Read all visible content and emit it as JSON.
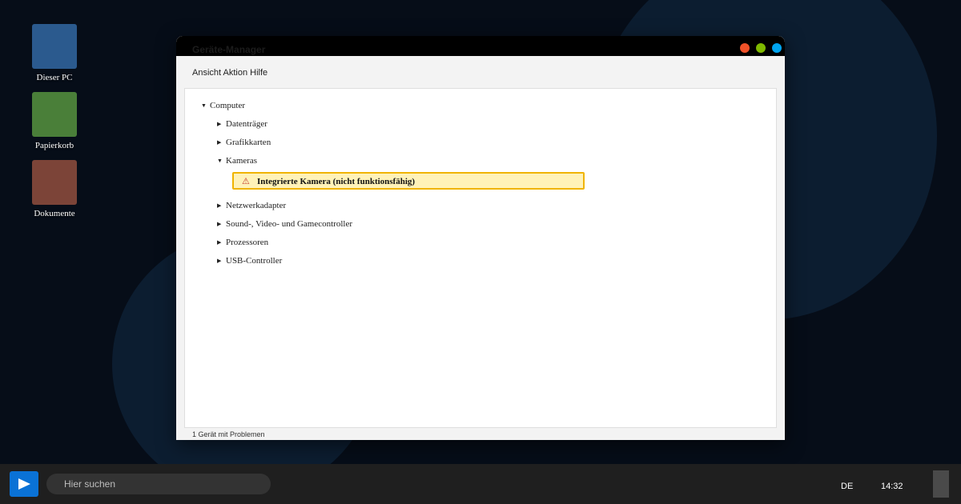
{
  "desktop": {
    "icons": [
      {
        "label": "Dieser PC",
        "color": "#2b5a8e"
      },
      {
        "label": "Papierkorb",
        "color": "#4a7f39"
      },
      {
        "label": "Dokumente",
        "color": "#7c4438"
      }
    ]
  },
  "window": {
    "title": "Geräte-Manager",
    "controls": {
      "close_color": "#ef5128",
      "minimize_color": "#7fb900",
      "maximize_color": "#00a4ef"
    },
    "menu": "Ansicht Aktion Hilfe",
    "tree": {
      "root": "Computer",
      "items": [
        "Datenträger",
        "Grafikkarten",
        "Kameras",
        "Netzwerkadapter",
        "Sound-, Video- und Gamecontroller",
        "Prozessoren",
        "USB-Controller"
      ],
      "camera_device": "Integrierte Kamera (nicht funktionsfähig)",
      "warning_icon": "warning-triangle-icon"
    },
    "status": "1 Gerät mit Problemen"
  },
  "taskbar": {
    "search_placeholder": "Hier suchen",
    "language": "DE",
    "time": "14:32",
    "start_color": "#0a72d6"
  }
}
